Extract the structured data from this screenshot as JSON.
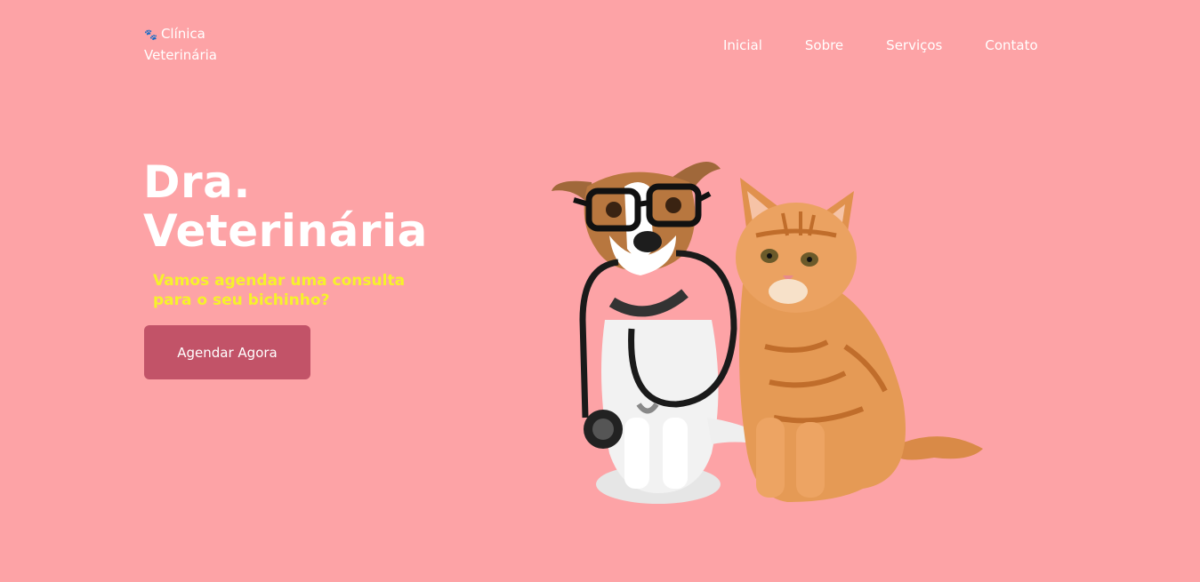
{
  "header": {
    "brand_line1": "Clínica",
    "brand_line2": "Veterinária",
    "brand_icon": "paw-icon",
    "nav": [
      {
        "label": "Inicial"
      },
      {
        "label": "Sobre"
      },
      {
        "label": "Serviços"
      },
      {
        "label": "Contato"
      }
    ]
  },
  "hero": {
    "title_line1": "Dra.",
    "title_line2": "Veterinária",
    "subtitle_line1": "Vamos agendar uma consulta",
    "subtitle_line2": "para o seu bichinho?",
    "cta_label": "Agendar Agora"
  },
  "colors": {
    "background": "#fda3a6",
    "accent_button": "#c25368",
    "subtitle": "#f6f22a",
    "text": "#ffffff"
  }
}
